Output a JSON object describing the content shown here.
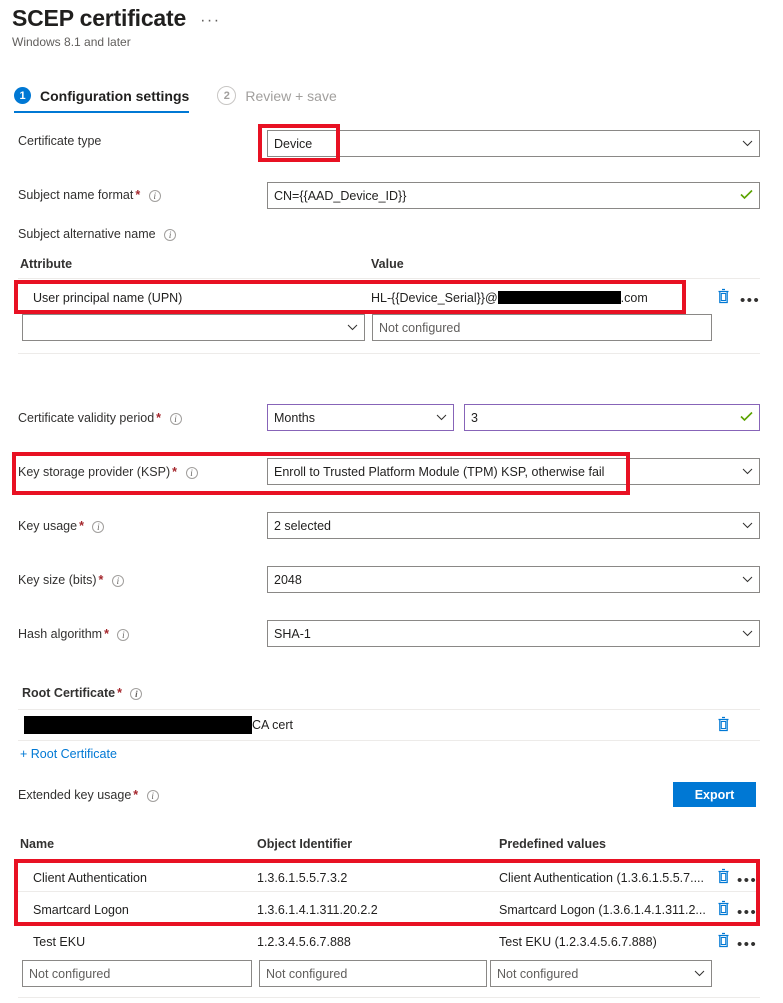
{
  "header": {
    "title": "SCEP certificate",
    "subtitle": "Windows 8.1 and later",
    "ellipsis": "···"
  },
  "tabs": [
    {
      "num": "1",
      "label": "Configuration settings",
      "state": "active"
    },
    {
      "num": "2",
      "label": "Review + save",
      "state": "inactive"
    }
  ],
  "fields": {
    "certificate_type": {
      "label": "Certificate type",
      "value": "Device",
      "required": false,
      "info": false
    },
    "subject_name_format": {
      "label": "Subject name format",
      "value": "CN={{AAD_Device_ID}}",
      "required": true,
      "info": true,
      "valid": true
    },
    "subject_alternative_name": {
      "label": "Subject alternative name",
      "required": false,
      "info": true
    },
    "certificate_validity_period": {
      "label": "Certificate validity period",
      "required": true,
      "info": true,
      "unit": "Months",
      "amount": "3",
      "valid": true
    },
    "key_storage_provider": {
      "label": "Key storage provider (KSP)",
      "required": true,
      "info": true,
      "value": "Enroll to Trusted Platform Module (TPM) KSP, otherwise fail"
    },
    "key_usage": {
      "label": "Key usage",
      "required": true,
      "info": true,
      "value": "2 selected"
    },
    "key_size": {
      "label": "Key size (bits)",
      "required": true,
      "info": true,
      "value": "2048"
    },
    "hash_algorithm": {
      "label": "Hash algorithm",
      "required": true,
      "info": true,
      "value": "SHA-1"
    },
    "root_certificate": {
      "label": "Root Certificate",
      "required": true,
      "info": true
    },
    "extended_key_usage": {
      "label": "Extended key usage",
      "required": true,
      "info": true
    }
  },
  "san_table": {
    "headers": {
      "attribute": "Attribute",
      "value": "Value"
    },
    "rows": [
      {
        "attribute": "User principal name (UPN)",
        "value_prefix": "HL-{{Device_Serial}}@",
        "value_redacted": true,
        "value_suffix": ".com",
        "highlighted": true
      }
    ],
    "new_row": {
      "attribute_placeholder": "",
      "value_placeholder": "Not configured"
    }
  },
  "root_certificate_table": {
    "rows": [
      {
        "name_redacted": true,
        "name_suffix": "CA cert"
      }
    ],
    "add_link": "+ Root Certificate"
  },
  "export_button": {
    "label": "Export"
  },
  "eku_table": {
    "headers": {
      "name": "Name",
      "oid": "Object Identifier",
      "predefined": "Predefined values"
    },
    "rows": [
      {
        "name": "Client Authentication",
        "oid": "1.3.6.1.5.5.7.3.2",
        "predefined": "Client Authentication (1.3.6.1.5.5.7....",
        "highlighted": true
      },
      {
        "name": "Smartcard Logon",
        "oid": "1.3.6.1.4.1.311.20.2.2",
        "predefined": "Smartcard Logon (1.3.6.1.4.1.311.2...",
        "highlighted": true
      },
      {
        "name": "Test EKU",
        "oid": "1.2.3.4.5.6.7.888",
        "predefined": "Test EKU (1.2.3.4.5.6.7.888)",
        "highlighted": false
      }
    ],
    "new_row": {
      "name_placeholder": "Not configured",
      "oid_placeholder": "Not configured",
      "predefined_placeholder": "Not configured"
    }
  },
  "icons": {
    "delete": "trash-icon",
    "more": "ellipsis-icon",
    "chevron": "chevron-down-icon",
    "valid": "checkmark-icon",
    "info": "info-icon"
  },
  "colors": {
    "accent": "#0078d4",
    "highlight": "#e81123",
    "required": "#a4262c",
    "valid": "#5ba300",
    "purple_border": "#8764b8"
  }
}
